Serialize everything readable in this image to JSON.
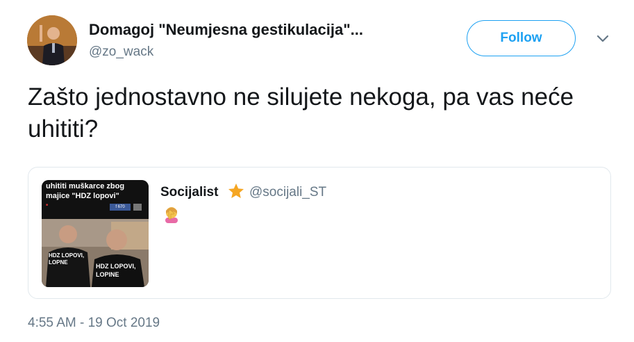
{
  "author": {
    "display_name": "Domagoj \"Neumjesna gestikulacija\"...",
    "handle": "@zo_wack",
    "avatar_icon": "avatar-photo"
  },
  "header": {
    "follow_label": "Follow",
    "menu_icon": "chevron-down-icon"
  },
  "tweet": {
    "text": "Zašto jednostavno ne silujete nekoga, pa vas neće uhititi?",
    "timestamp": "4:55 AM - 19 Oct 2019"
  },
  "quoted_tweet": {
    "author_name": "Socijalist",
    "badge_icon": "star-icon",
    "handle": "@socijali_ST",
    "text": "🤦‍♀️",
    "thumbnail": {
      "headline": "uhititi muškarce zbog majice \"HDZ lopovi\"",
      "shirt_text_left": "HDZ LOPOVI, LOPNE",
      "shirt_text_right": "HDZ LOPOVI, LOPINE",
      "facebook_count": "f 670"
    }
  },
  "colors": {
    "accent": "#1da1f2",
    "text_primary": "#14171a",
    "text_secondary": "#657786",
    "border": "#e1e8ed",
    "star": "#f5a623"
  }
}
